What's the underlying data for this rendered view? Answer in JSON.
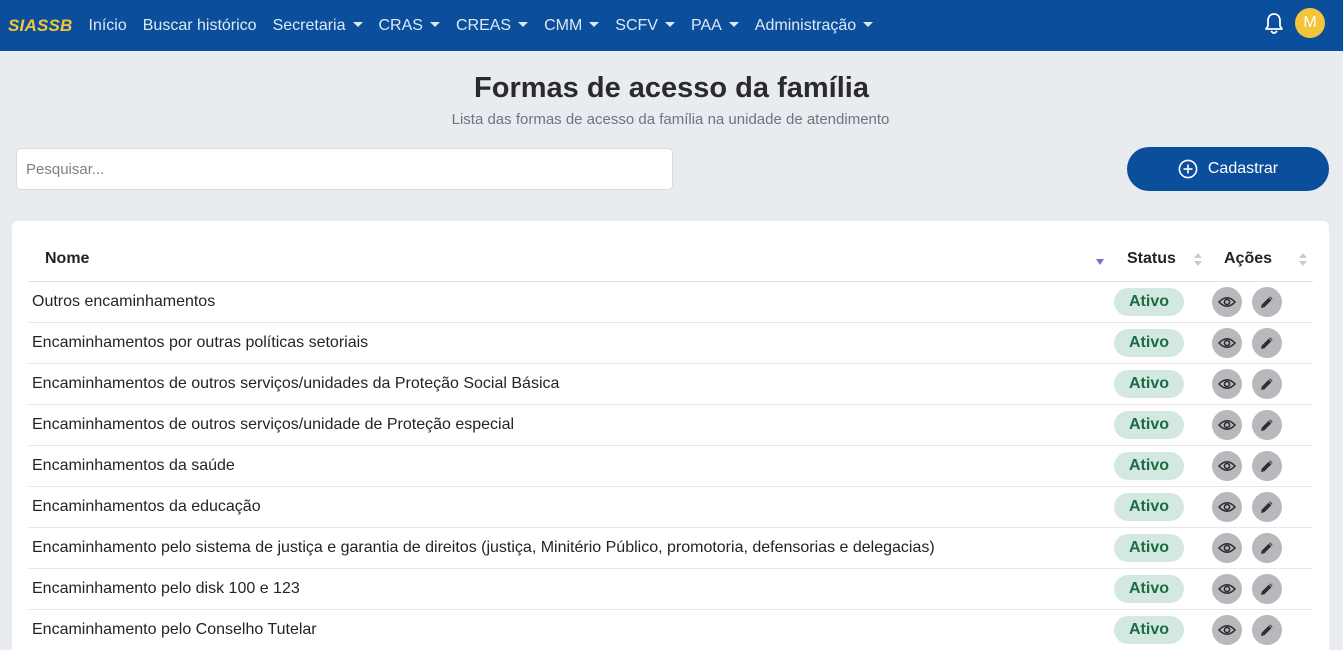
{
  "brand": "SIASSB",
  "nav": [
    {
      "label": "Início",
      "dropdown": false
    },
    {
      "label": "Buscar histórico",
      "dropdown": false
    },
    {
      "label": "Secretaria",
      "dropdown": true
    },
    {
      "label": "CRAS",
      "dropdown": true
    },
    {
      "label": "CREAS",
      "dropdown": true
    },
    {
      "label": "CMM",
      "dropdown": true
    },
    {
      "label": "SCFV",
      "dropdown": true
    },
    {
      "label": "PAA",
      "dropdown": true
    },
    {
      "label": "Administração",
      "dropdown": true
    }
  ],
  "user": {
    "initial": "M"
  },
  "page": {
    "title": "Formas de acesso da família",
    "subtitle": "Lista das formas de acesso da família na unidade de atendimento"
  },
  "search": {
    "placeholder": "Pesquisar..."
  },
  "add_button": {
    "label": "Cadastrar",
    "icon": "plus-circle-icon"
  },
  "table": {
    "columns": {
      "name": "Nome",
      "status": "Status",
      "actions": "Ações"
    },
    "rows": [
      {
        "name": "Outros encaminhamentos",
        "status": "Ativo"
      },
      {
        "name": "Encaminhamentos por outras políticas setoriais",
        "status": "Ativo"
      },
      {
        "name": "Encaminhamentos de outros serviços/unidades da Proteção Social Básica",
        "status": "Ativo"
      },
      {
        "name": "Encaminhamentos de outros serviços/unidade de Proteção especial",
        "status": "Ativo"
      },
      {
        "name": "Encaminhamentos da saúde",
        "status": "Ativo"
      },
      {
        "name": "Encaminhamentos da educação",
        "status": "Ativo"
      },
      {
        "name": "Encaminhamento pelo sistema de justiça e garantia de direitos (justiça, Minitério Público, promotoria, defensorias e delegacias)",
        "status": "Ativo"
      },
      {
        "name": "Encaminhamento pelo disk 100 e 123",
        "status": "Ativo"
      },
      {
        "name": "Encaminhamento pelo Conselho Tutelar",
        "status": "Ativo"
      }
    ]
  },
  "colors": {
    "navbar": "#0b4f9c",
    "brand": "#f2c53a",
    "badge_bg": "#d3e8e0",
    "badge_text": "#1d6b45",
    "background": "#e8ebf0"
  }
}
